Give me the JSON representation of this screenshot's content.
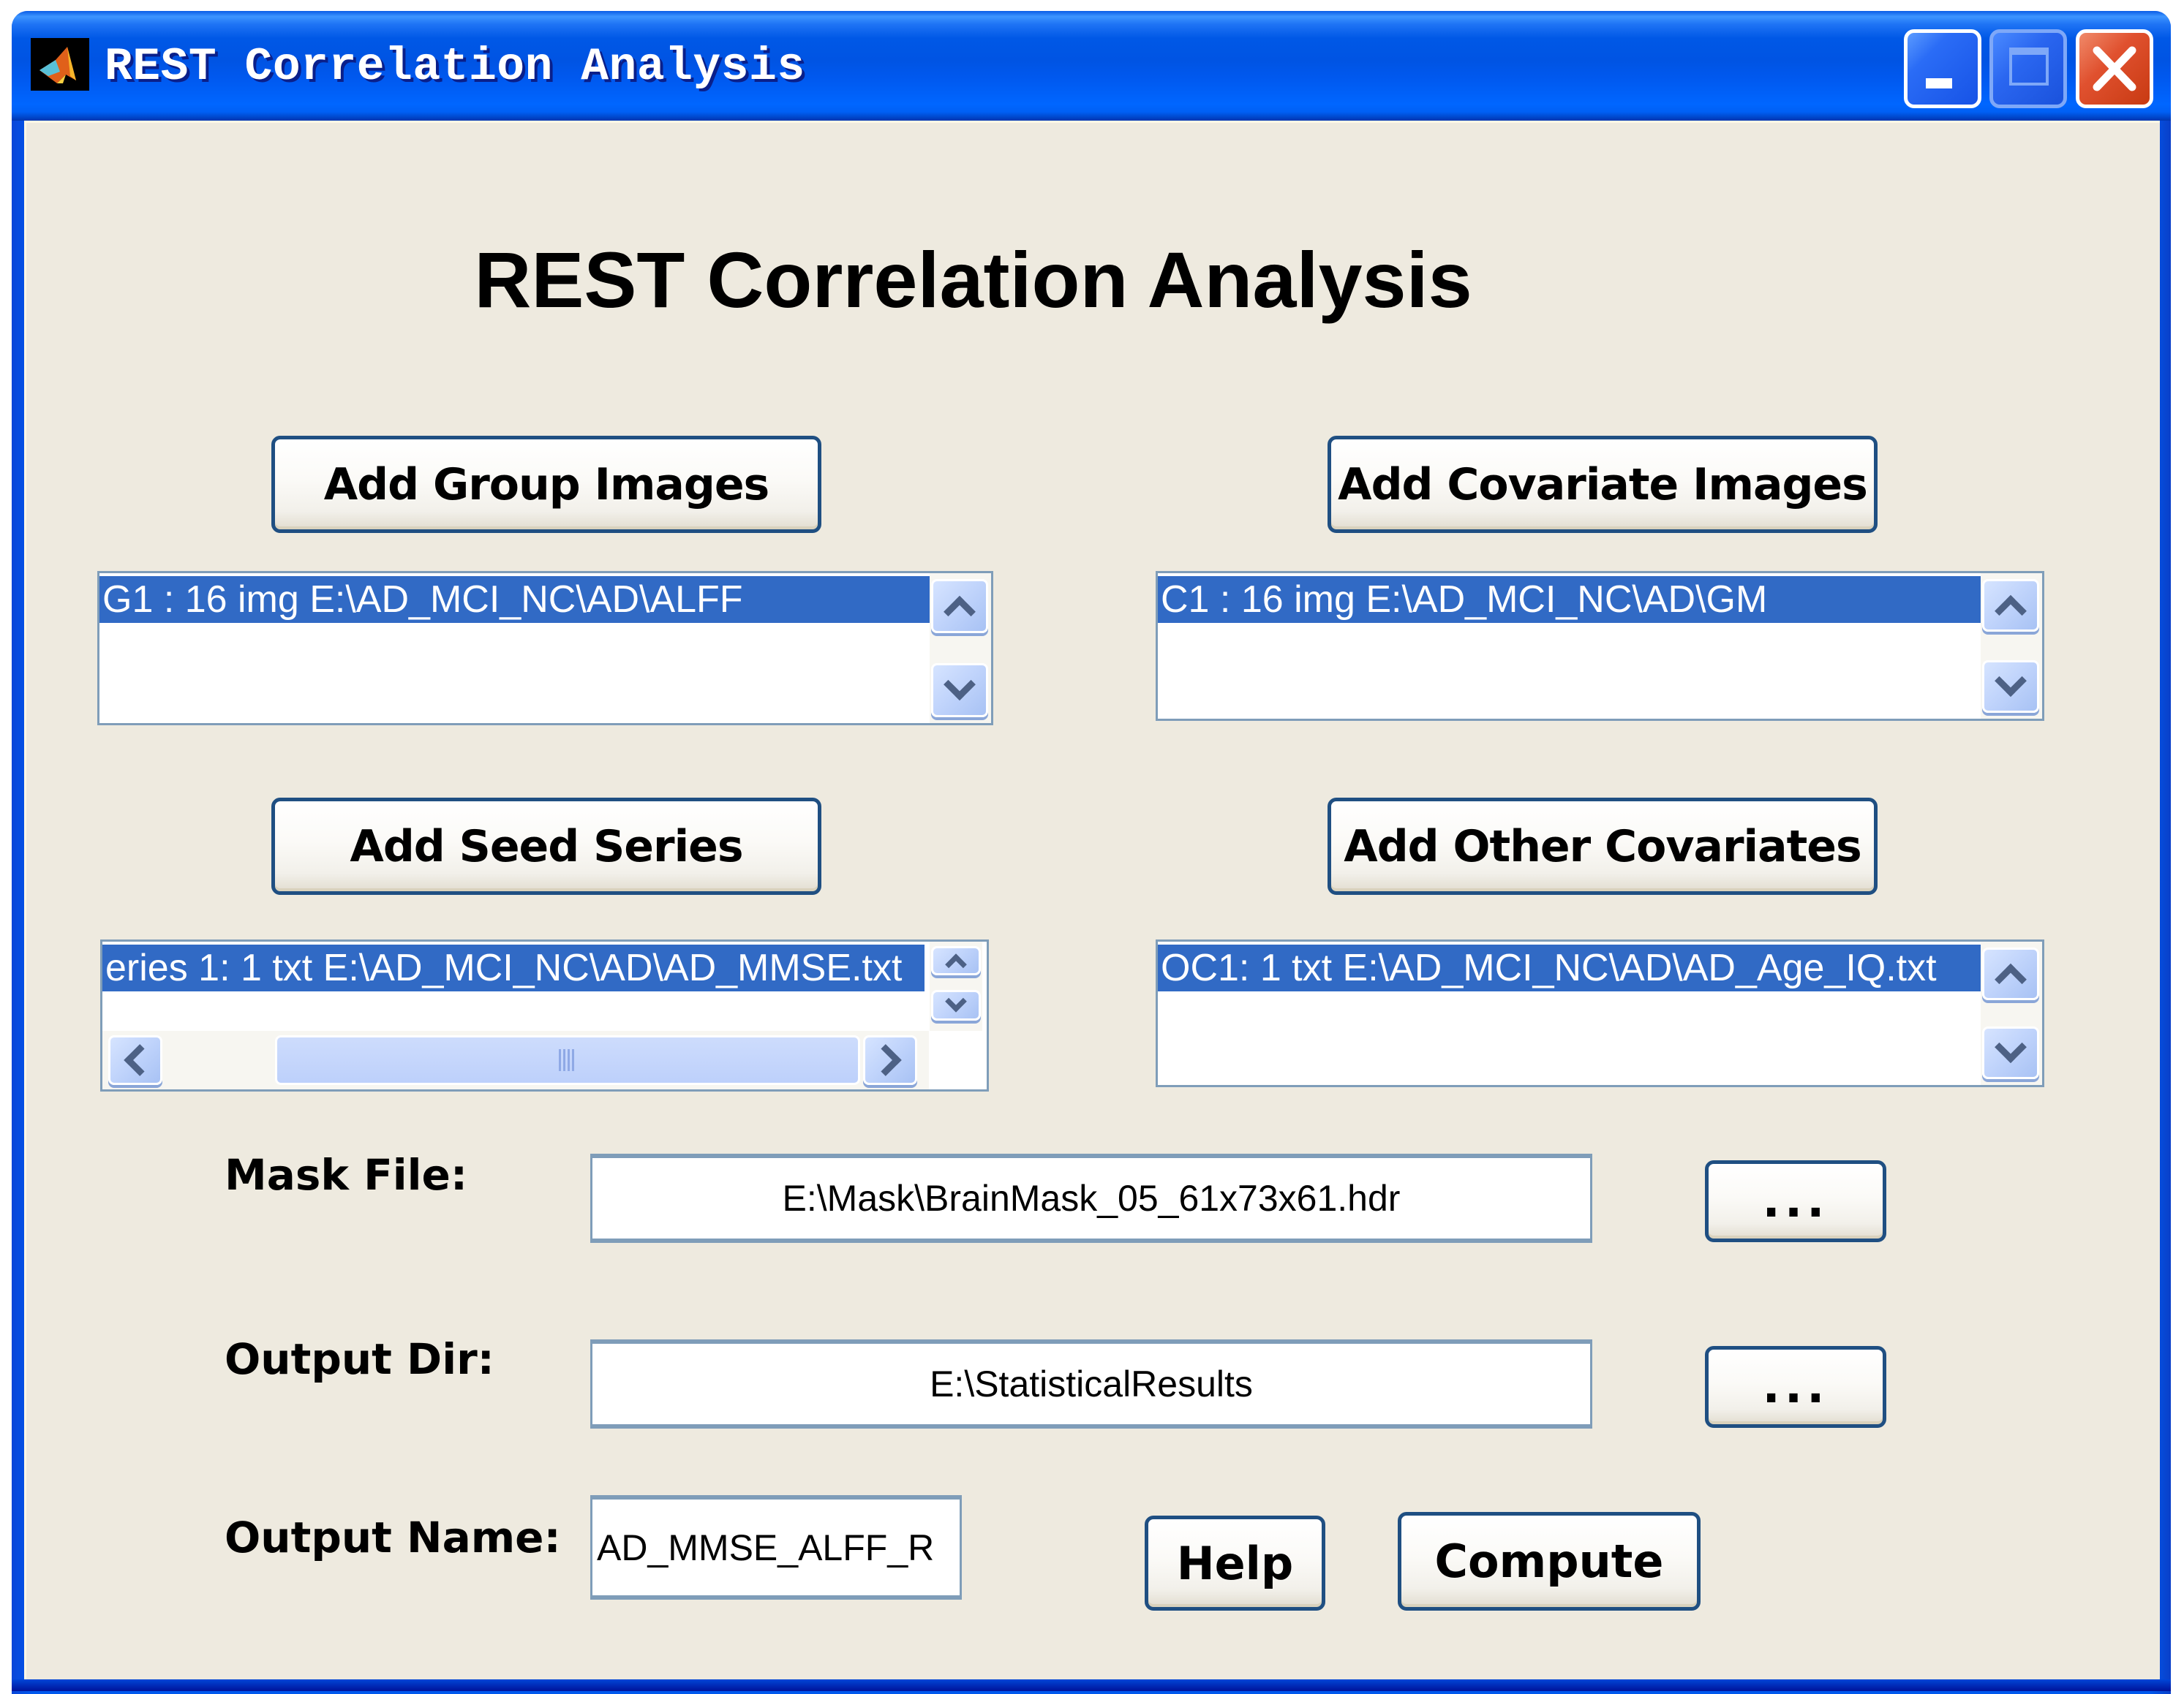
{
  "window": {
    "title": "REST Correlation Analysis",
    "app_icon": "matlab-icon",
    "controls": {
      "minimize": "minimize-icon",
      "maximize": "maximize-icon",
      "close": "close-icon"
    },
    "colors": {
      "titlebar": "#0054e3",
      "client_bg": "#eeeadf",
      "selection": "#316ac5",
      "button_border": "#1f4f82"
    }
  },
  "heading": "REST Correlation Analysis",
  "group_images": {
    "button_label": "Add Group Images",
    "list": [
      "G1 : 16 img E:\\AD_MCI_NC\\AD\\ALFF"
    ],
    "selected_index": 0
  },
  "covariate_images": {
    "button_label": "Add Covariate Images",
    "list": [
      "C1 : 16 img E:\\AD_MCI_NC\\AD\\GM"
    ],
    "selected_index": 0
  },
  "seed_series": {
    "button_label": "Add Seed Series",
    "list": [
      "eries 1: 1 txt E:\\AD_MCI_NC\\AD\\AD_MMSE.txt"
    ],
    "selected_index": 0,
    "horizontal_scroll_percent": 100
  },
  "other_covariates": {
    "button_label": "Add Other Covariates",
    "list": [
      "OC1: 1 txt E:\\AD_MCI_NC\\AD\\AD_Age_IQ.txt"
    ],
    "selected_index": 0
  },
  "mask_file": {
    "label": "Mask File:",
    "value": "E:\\Mask\\BrainMask_05_61x73x61.hdr",
    "browse_label": "..."
  },
  "output_dir": {
    "label": "Output Dir:",
    "value": "E:\\StatisticalResults",
    "browse_label": "..."
  },
  "output_name": {
    "label": "Output Name:",
    "value": "AD_MMSE_ALFF_R"
  },
  "actions": {
    "help_label": "Help",
    "compute_label": "Compute"
  }
}
